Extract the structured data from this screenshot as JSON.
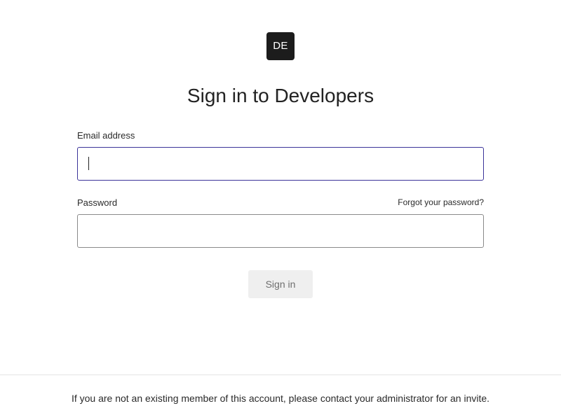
{
  "logo": {
    "text": "DE"
  },
  "header": {
    "title": "Sign in to Developers"
  },
  "form": {
    "email": {
      "label": "Email address",
      "value": "",
      "placeholder": ""
    },
    "password": {
      "label": "Password",
      "value": "",
      "placeholder": ""
    },
    "forgot_link": "Forgot your password?",
    "submit_label": "Sign in"
  },
  "footer": {
    "text": "If you are not an existing member of this account, please contact your administrator for an invite."
  },
  "colors": {
    "focus_border": "#3b3399",
    "logo_background": "#1c1c1c",
    "button_background": "#efefef"
  }
}
